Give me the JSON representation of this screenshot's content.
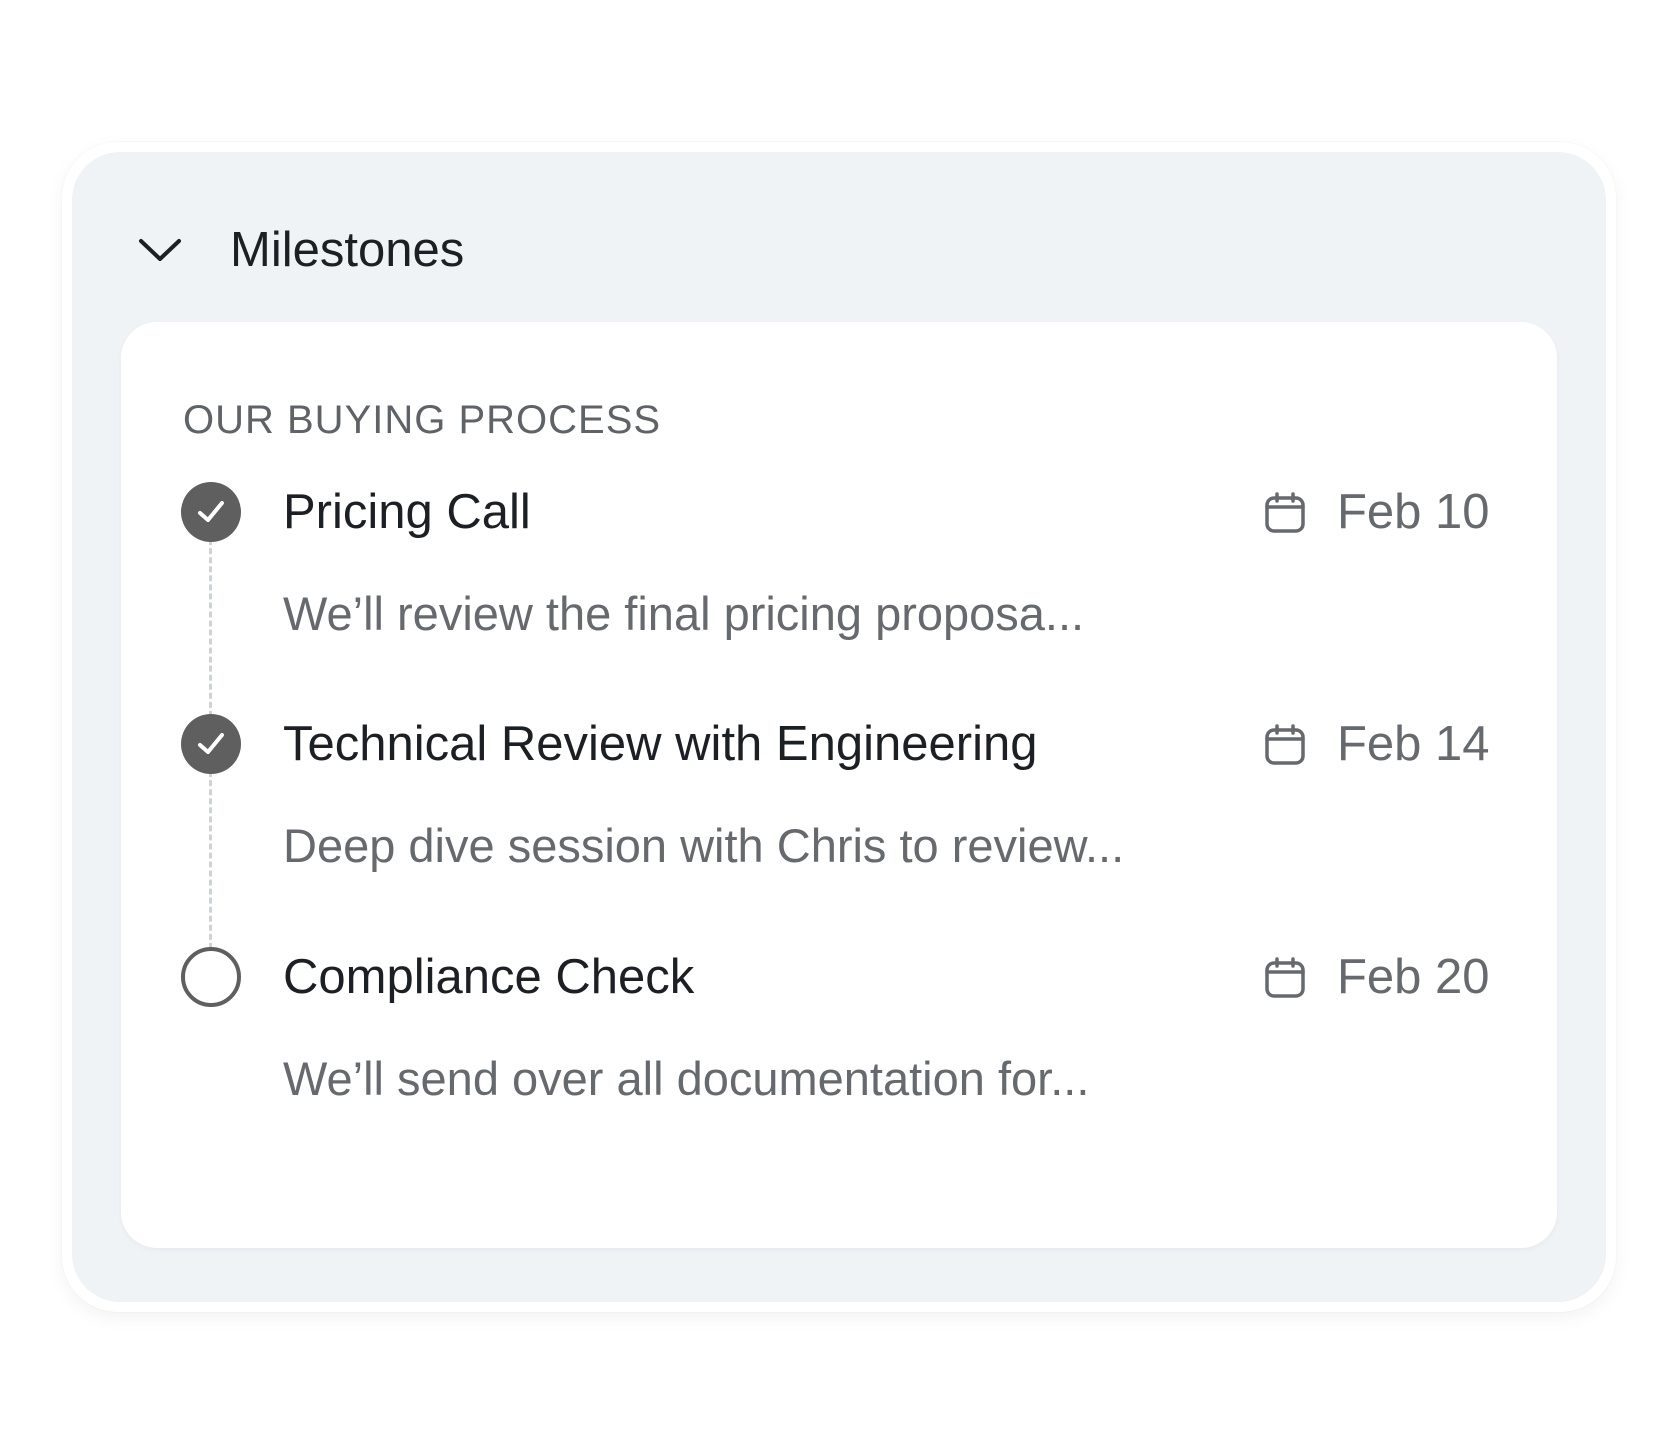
{
  "panel": {
    "title": "Milestones",
    "collapse_icon": "chevron-down-icon"
  },
  "card": {
    "section_label": "OUR BUYING PROCESS",
    "milestones": [
      {
        "title": "Pricing Call",
        "description": "We’ll review the final pricing proposa...",
        "date": "Feb 10",
        "status": "completed",
        "status_icon": "check-circle-icon",
        "date_icon": "calendar-icon"
      },
      {
        "title": "Technical Review with Engineering",
        "description": "Deep dive session with Chris to review...",
        "date": "Feb 14",
        "status": "completed",
        "status_icon": "check-circle-icon",
        "date_icon": "calendar-icon"
      },
      {
        "title": "Compliance Check",
        "description": "We’ll send over all documentation for...",
        "date": "Feb 20",
        "status": "pending",
        "status_icon": "empty-circle-icon",
        "date_icon": "calendar-icon"
      }
    ]
  },
  "colors": {
    "panel_background": "#eff3f6",
    "card_background": "#ffffff",
    "status_fill": "#5f5f5f",
    "title_text": "#1c1f24",
    "muted_text": "#66696e"
  }
}
